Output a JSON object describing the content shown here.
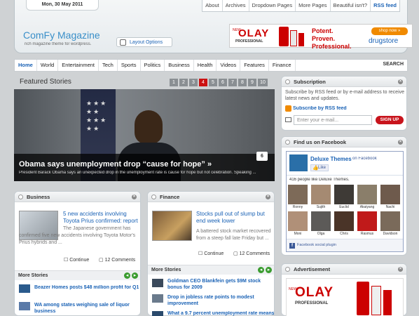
{
  "header": {
    "date": "Mon, 30 May 2011",
    "top_links": [
      "About",
      "Archives",
      "Dropdown Pages",
      "More Pages",
      "Beautiful isn't?",
      "RSS feed"
    ],
    "logo": "ComFy Magazine",
    "tagline": "rich magazine theme for wordpress.",
    "layout_button": "Layout Options",
    "ad": {
      "brand_new": "NEW",
      "brand": "OLAY",
      "brand_sub": "PROFESSIONAL",
      "slogan": "Potent. Proven. Professional.",
      "shop_btn": "shop now »",
      "store": "drugstore"
    }
  },
  "nav": {
    "items": [
      "Home",
      "World",
      "Entertainment",
      "Tech",
      "Sports",
      "Politics",
      "Business",
      "Health",
      "Videos",
      "Features",
      "Finance"
    ],
    "search_label": "SEARCH"
  },
  "featured": {
    "title": "Featured Stories",
    "pages": [
      "1",
      "2",
      "3",
      "4",
      "5",
      "6",
      "7",
      "8",
      "9",
      "10"
    ],
    "active_page": "4",
    "headline": "Obama says unemployment drop “cause for hope” »",
    "caption": "President Barack Obama says an unexpected drop in the unemployment rate is cause for hope but not celebration. Speaking ...",
    "comments": "6"
  },
  "business": {
    "title": "Business",
    "headline": "5 new accidents involving Toyota Prius confirmed: report",
    "excerpt": "The Japanese government has confirmed five new accidents involving Toyota Motor's Prius hybrids and ...",
    "continue": "Continue",
    "comments": "12 Comments",
    "more_title": "More Stories",
    "more": [
      "Beazer Homes posts $48 million profit for Q1",
      "WA among states weighing sale of liquor business"
    ]
  },
  "finance": {
    "title": "Finance",
    "headline": "Stocks pull out of slump but end week lower",
    "excerpt": "A battered stock market recovered from a steep fall late Friday but ...",
    "continue": "Continue",
    "comments": "12 Comments",
    "more_title": "More Stories",
    "more": [
      "Goldman CEO Blankfein gets $9M stock bonus for 2009",
      "Drop in jobless rate points to modest improvement",
      "What a 9.7 percent unemployment rate means"
    ]
  },
  "subscription": {
    "title": "Subscription",
    "text": "Subscribe by RSS feed or by e-mail address to receive latest news and updates.",
    "rss_link": "Subscribe by RSS feed",
    "email_placeholder": "Enter your e-mail...",
    "signup": "SIGN UP"
  },
  "facebook": {
    "title": "Find us on Facebook",
    "page_name": "Deluxe Themes",
    "on_facebook": "on Facebook",
    "like": "Like",
    "count_text": "416 people like Deluxe Themes.",
    "people": [
      "Ronny",
      "Sujith",
      "Euclid",
      "Akaiyang",
      "Nachi",
      "Moni",
      "Olga",
      "Chris",
      "Rasmus",
      "Davidson"
    ],
    "social_plugin": "Facebook social plugin"
  },
  "advertisement": {
    "title": "Advertisement"
  },
  "colors": {
    "accent": "#1a62b5",
    "signup_red": "#c8141c",
    "olay_red": "#d0021b",
    "page_active": "#cc1111"
  }
}
